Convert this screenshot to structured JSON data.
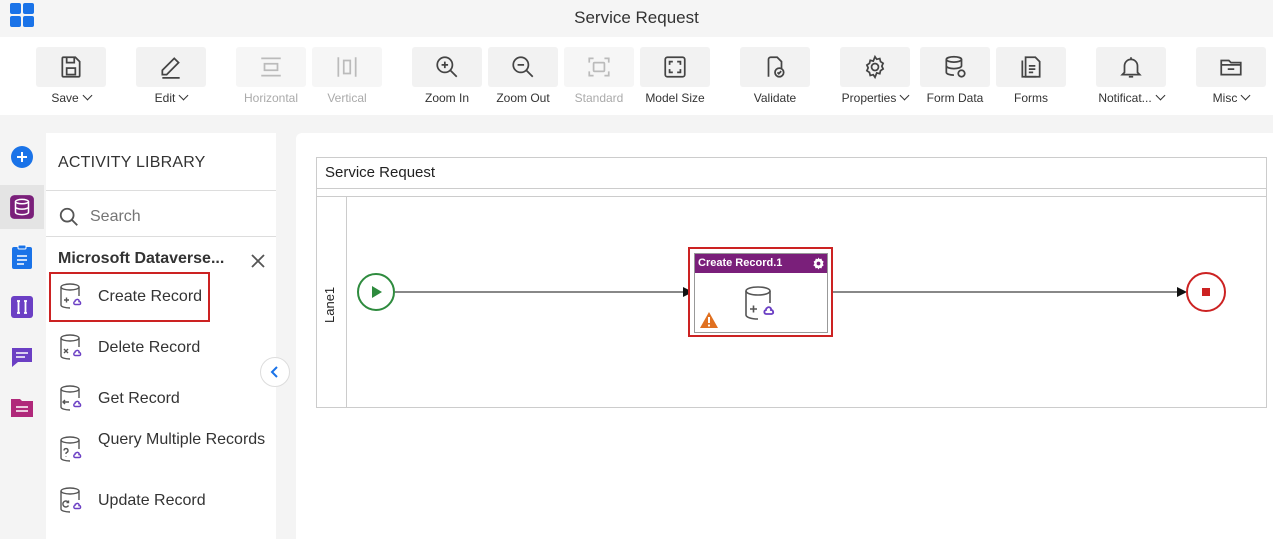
{
  "window": {
    "title": "Service Request"
  },
  "toolbar": {
    "save": "Save",
    "edit": "Edit",
    "horizontal": "Horizontal",
    "vertical": "Vertical",
    "zoom_in": "Zoom In",
    "zoom_out": "Zoom Out",
    "standard": "Standard",
    "model_size": "Model Size",
    "validate": "Validate",
    "properties": "Properties",
    "form_data": "Form Data",
    "forms": "Forms",
    "notifications": "Notificat...",
    "misc": "Misc"
  },
  "library": {
    "title": "ACTIVITY LIBRARY",
    "search_placeholder": "Search",
    "group": "Microsoft Dataverse...",
    "items": [
      {
        "label": "Create Record"
      },
      {
        "label": "Delete Record"
      },
      {
        "label": "Get Record"
      },
      {
        "label": "Query Multiple Records"
      },
      {
        "label": "Update Record"
      }
    ]
  },
  "canvas": {
    "pool_title": "Service Request",
    "lane_title": "Lane1",
    "task_title": "Create Record.1"
  },
  "colors": {
    "accent": "#1a73e8",
    "task_header": "#7a1f7a",
    "highlight": "#cc2222",
    "start": "#2e8b3e",
    "end": "#cc2222"
  }
}
